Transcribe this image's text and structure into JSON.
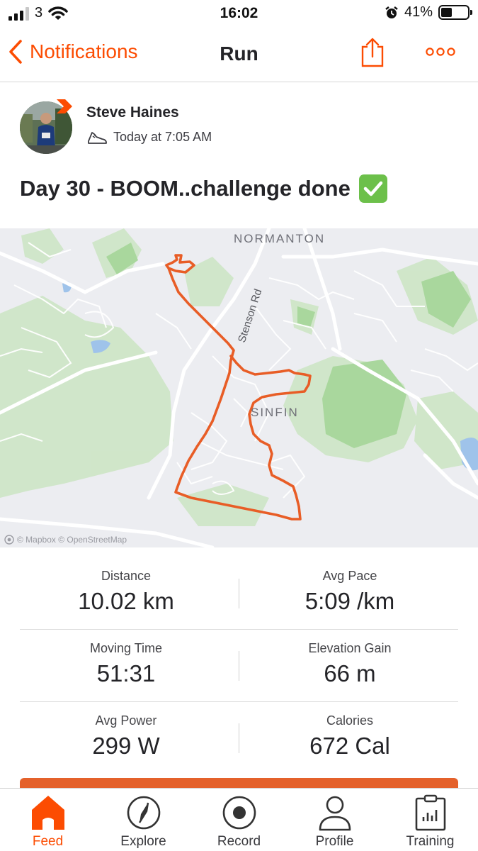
{
  "status_bar": {
    "carrier": "3",
    "time": "16:02",
    "battery": "41%",
    "battery_level": 0.41
  },
  "nav": {
    "back_label": "Notifications",
    "title": "Run",
    "share_icon": "share-icon",
    "more_icon": "more-icon"
  },
  "athlete": {
    "name": "Steve Haines",
    "activity_icon": "shoe-icon",
    "time": "Today at 7:05 AM"
  },
  "activity": {
    "title": "Day 30 - BOOM..challenge done",
    "emoji": "✅"
  },
  "map": {
    "labels": {
      "normanton": "NORMANTON",
      "sinfin": "SINFIN",
      "road": "Stenson Rd"
    },
    "attribution": "© Mapbox © OpenStreetMap",
    "route_color": "#e85d26"
  },
  "stats": [
    {
      "left": {
        "label": "Distance",
        "value": "10.02 km"
      },
      "right": {
        "label": "Avg Pace",
        "value": "5:09 /km"
      }
    },
    {
      "left": {
        "label": "Moving Time",
        "value": "51:31"
      },
      "right": {
        "label": "Elevation Gain",
        "value": "66 m"
      }
    },
    {
      "left": {
        "label": "Avg Power",
        "value": "299 W"
      },
      "right": {
        "label": "Calories",
        "value": "672 Cal"
      }
    }
  ],
  "tabs": [
    {
      "label": "Feed",
      "icon": "home-icon",
      "active": true
    },
    {
      "label": "Explore",
      "icon": "compass-icon",
      "active": false
    },
    {
      "label": "Record",
      "icon": "record-icon",
      "active": false
    },
    {
      "label": "Profile",
      "icon": "profile-icon",
      "active": false
    },
    {
      "label": "Training",
      "icon": "training-icon",
      "active": false
    }
  ],
  "colors": {
    "accent": "#fc4c02",
    "text": "#242428"
  }
}
